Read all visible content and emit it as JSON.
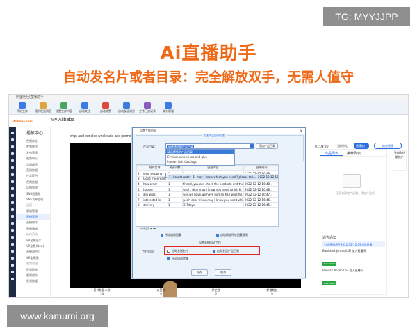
{
  "watermarks": {
    "tg": "TG: MYYJJPP",
    "site": "www.kamumi.org"
  },
  "headline": "Ai直播助手",
  "subhead": "自动发名片或者目录：完全解放双手，无需人值守",
  "app": {
    "window_title": "阿里巴巴直播助手",
    "toolbar": [
      {
        "label": "开始工作",
        "icon": "play-icon",
        "color": "#3c7ce0"
      },
      {
        "label": "随机发送消息",
        "icon": "shuffle-icon",
        "color": "#e0a63c"
      },
      {
        "label": "设置工作内容",
        "icon": "gear-icon",
        "color": "#4aa65c"
      },
      {
        "label": "自动关注",
        "icon": "eye-icon",
        "color": "#3c7ce0"
      },
      {
        "label": "自动点赞",
        "icon": "heart-icon",
        "color": "#e0483c"
      },
      {
        "label": "自动发送消息",
        "icon": "chat-icon",
        "color": "#3c7ce0"
      },
      {
        "label": "工作日志记录",
        "icon": "log-icon",
        "color": "#8a5cc0"
      },
      {
        "label": "联系客服",
        "icon": "support-icon",
        "color": "#3c7ce0"
      }
    ],
    "header_title": "My Alibaba",
    "logo_text": "Alibaba.com",
    "nav_head": "播放中心",
    "nav_items": [
      "视频作业",
      "视频制作",
      "发布管理",
      "视频中心",
      "品牌展示",
      "直播数据",
      "产品提供",
      "视频数据",
      "店铺管理",
      "SNS短视频",
      "SNS发布管理",
      "运营",
      "营销管理",
      "直播管理",
      "直播制作",
      "直播通知",
      "站内活动",
      "VR全景展厅",
      "VR全景(New)",
      "直播间中心",
      "VR全景图",
      "视频管理",
      "视频投放",
      "视频成交",
      "视频数据"
    ],
    "stage_text": "wigs and bundles wholesale and promot...",
    "timer": "01:04:20",
    "header_buttons": [
      "当前中心",
      "直播推广",
      "结束直播"
    ],
    "right_tabs": [
      "商品列表",
      "推荐列表"
    ],
    "right_hint": "还没有添加产品哦，添加产品吧",
    "notices": {
      "title": "通告通知",
      "bar": "引流直播将于2022-12-12 09:00 开播",
      "events": [
        "Banished Jordan(US) 加入直播间",
        "Banisss Ahsen(US) 加入直播间"
      ],
      "tags": [
        "New Client",
        "New Client"
      ]
    },
    "far_right": "答辩和讲解推广",
    "bottom_stats": [
      {
        "label": "累计观看人数",
        "value": "14"
      },
      {
        "label": "点赞数",
        "value": "0"
      },
      {
        "label": "评论数",
        "value": "0"
      },
      {
        "label": "新增粉丝",
        "value": "0"
      }
    ],
    "dialog": {
      "title": "设置工作内容",
      "group_label": "发送产品目录设置",
      "select_label": "产品目录：",
      "select_value": "请选择您的产品目录",
      "dropdown_options": [
        "请选择您的产品目录",
        "Eyelash extensions and glue",
        "human hair Catalogs"
      ],
      "add_button": "添加产品目录",
      "columns": [
        "",
        "规则名称",
        "关键词数",
        "回复内容",
        "创建时间"
      ],
      "rows": [
        [
          "1",
          "How to order",
          "1",
          "may I know which you need ? please tell...",
          "2022-12-12 16:50..."
        ],
        [
          "2",
          "drop shipping",
          "1",
          "hi yeah,sure we can do, our many custome...",
          "2022-12-12 16:49..."
        ],
        [
          "3",
          "Good freedream",
          "1",
          "yeah dear friend,thank you",
          "2022-12-12 16:49..."
        ],
        [
          "4",
          "how order",
          "1",
          "friend, you can check the products and the...",
          "2022-12-12 16:48..."
        ],
        [
          "5",
          "hopper",
          "1",
          "yeah, dear,may i know you need which ki...",
          "2022-12-12 16:48..."
        ],
        [
          "6",
          "any wigs",
          "1",
          "yes,we have.we have human hair wigs,ful...",
          "2022-12-12 16:47..."
        ],
        [
          "7",
          "interested in",
          "1",
          "yeah dear friend,may I know you need whi...",
          "2022-12-12 16:46..."
        ],
        [
          "8",
          "delivery",
          "1",
          "3-7days",
          "2022-12-12 16:45..."
        ]
      ],
      "table_footer": "共8条记录 ◀ 1 ▶",
      "opt_reply_rules": "评论机制回复",
      "opt_auto_eval": "自动解放评论回复规则",
      "section_label": "设置直播自动工作",
      "mode_label": "工作内容:",
      "opt_send_card": "自动发送名片",
      "opt_send_catalog": "自动发送产品目录",
      "opt_auto_follow": "评论自动提醒",
      "save_button": "保存",
      "cancel_button": "取消"
    },
    "badge": "GT"
  }
}
